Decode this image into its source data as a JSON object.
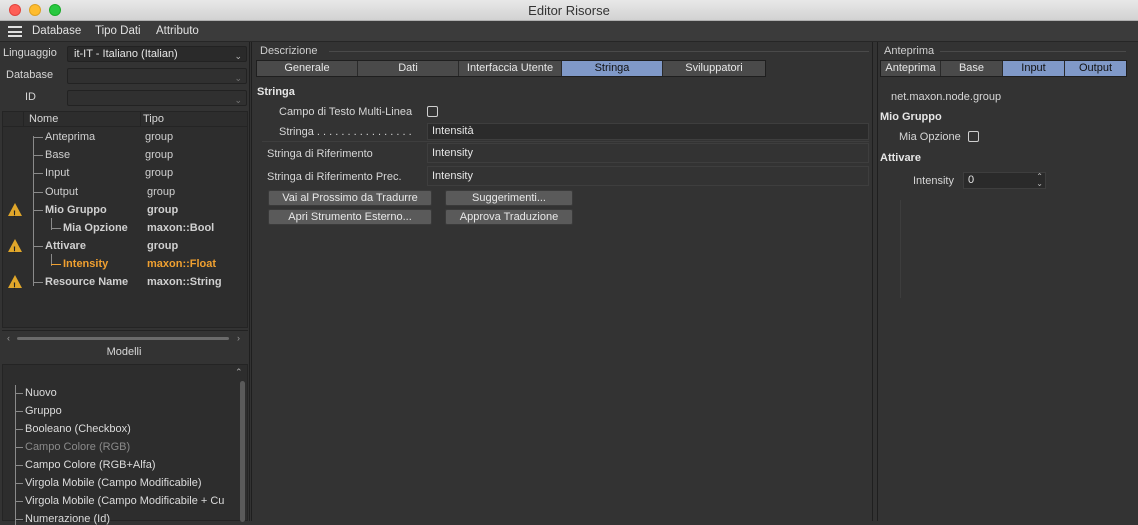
{
  "window": {
    "title": "Editor Risorse"
  },
  "menu": [
    "Database",
    "Tipo Dati",
    "Attributo"
  ],
  "left": {
    "language_label": "Linguaggio",
    "language_value": "it-IT - Italiano (Italian)",
    "database_label": "Database",
    "database_value": "",
    "id_label": "ID",
    "id_value": "",
    "tree_headers": [
      "Nome",
      "Tipo"
    ],
    "tree_rows": [
      {
        "name": "Anteprima",
        "type": "group"
      },
      {
        "name": "Base",
        "type": "group"
      },
      {
        "name": "Input",
        "type": "group"
      },
      {
        "name": "Output",
        "type": "group"
      },
      {
        "name": "Mio Gruppo",
        "type": "group"
      },
      {
        "name": "Mia Opzione",
        "type": "maxon::Bool"
      },
      {
        "name": "Attivare",
        "type": "group"
      },
      {
        "name": "Intensity",
        "type": "maxon::Float"
      },
      {
        "name": "Resource Name",
        "type": "maxon::String"
      }
    ],
    "models_title": "Modelli",
    "models": [
      "Nuovo",
      "Gruppo",
      "Booleano (Checkbox)",
      "Campo Colore (RGB)",
      "Campo Colore (RGB+Alfa)",
      "Virgola Mobile (Campo Modificabile)",
      "Virgola Mobile (Campo Modificabile + Cu",
      "Numerazione (Id)"
    ]
  },
  "center": {
    "group_title": "Descrizione",
    "tabs": [
      "Generale",
      "Dati",
      "Interfaccia Utente",
      "Stringa",
      "Sviluppatori"
    ],
    "active_tab": "Stringa",
    "section_title": "Stringa",
    "multiline_label": "Campo di Testo Multi-Linea",
    "string_label": "Stringa . . . . . . . . . . . . . . . .",
    "string_value": "Intensità",
    "ref_label": "Stringa di Riferimento",
    "ref_value": "Intensity",
    "prev_ref_label": "Stringa di Riferimento Prec.",
    "prev_ref_value": "Intensity",
    "btn_next": "Vai al Prossimo da Tradurre",
    "btn_suggest": "Suggerimenti...",
    "btn_external": "Apri Strumento Esterno...",
    "btn_approve": "Approva Traduzione"
  },
  "right": {
    "group_title": "Anteprima",
    "tabs": [
      "Anteprima",
      "Base",
      "Input",
      "Output"
    ],
    "node_id": "net.maxon.node.group",
    "group1": "Mio Gruppo",
    "option_label": "Mia Opzione",
    "group2": "Attivare",
    "intensity_label": "Intensity",
    "intensity_value": "0"
  },
  "colors": {
    "accent": "#8099c8",
    "warning": "#e0a62a",
    "highlight": "#f0a030"
  }
}
